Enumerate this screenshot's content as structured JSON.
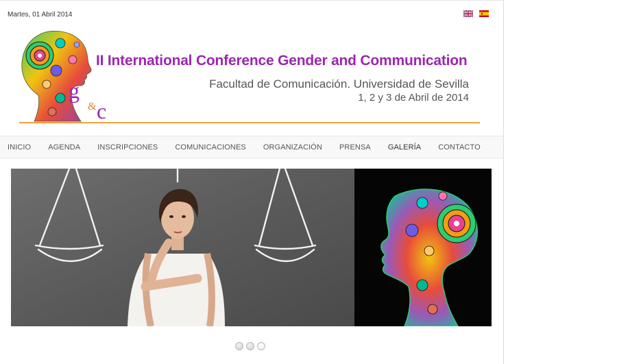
{
  "header": {
    "date": "Martes, 01 Abril 2014",
    "languages": [
      {
        "name": "english-flag",
        "label": "English"
      },
      {
        "name": "spanish-flag",
        "label": "Español"
      }
    ],
    "logo_text": {
      "g": "g",
      "amp": "&",
      "c": "c"
    },
    "title": "II International Conference Gender and Communication",
    "subtitle_line1": "Facultad de Comunicación. Universidad de Sevilla",
    "subtitle_line2": "1, 2 y 3 de Abril de 2014"
  },
  "nav": {
    "items": [
      {
        "label": "INICIO"
      },
      {
        "label": "AGENDA"
      },
      {
        "label": "INSCRIPCIONES"
      },
      {
        "label": "COMUNICACIONES"
      },
      {
        "label": "ORGANIZACIÓN"
      },
      {
        "label": "PRENSA"
      },
      {
        "label": "GALERÍA"
      },
      {
        "label": "CONTACTO"
      }
    ]
  },
  "slider": {
    "slide_count": 3,
    "active_index": 2
  },
  "colors": {
    "accent_purple": "#9b27b0",
    "rule_orange": "#e6a23c",
    "text_gray": "#555555"
  }
}
